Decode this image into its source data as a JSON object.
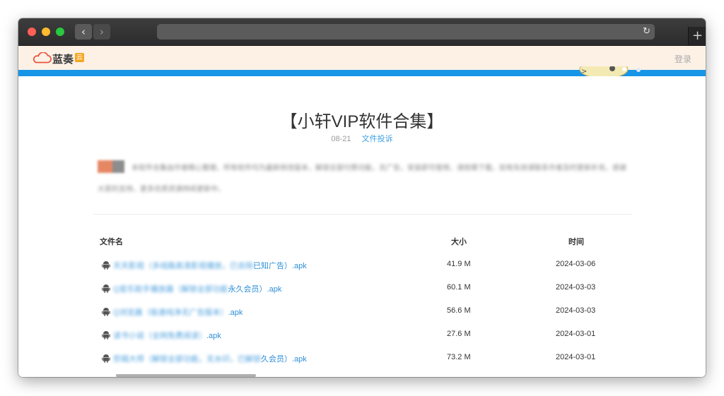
{
  "browser": {
    "back_glyph": "‹",
    "forward_glyph": "›",
    "reload_glyph": "↻",
    "newtab_glyph": "+"
  },
  "site": {
    "logo_text": "蓝奏",
    "logo_badge": "云",
    "login_label": "登录",
    "brand_color": "#1795e6"
  },
  "file": {
    "title": "【小轩VIP软件合集】",
    "date": "08-21",
    "report_label": "文件投诉",
    "description": "本软件合集由作者精心整理，所有软件均为最新修改版本，解锁全部付费功能，无广告，安装即可使用，请按需下载，如有失效请联系作者及时更新补充，感谢大家的支持，更多优质资源持续更新中。"
  },
  "table": {
    "headers": {
      "name": "文件名",
      "size": "大小",
      "time": "时间"
    },
    "rows": [
      {
        "name_hidden": "天天影视（多线路高清影视播放，已去除",
        "name_visible": "已知广告）.apk",
        "size": "41.9 M",
        "time": "2024-03-06"
      },
      {
        "name_hidden": "Q音乐助手播放器（解锁全部功能",
        "name_visible": "永久会员）.apk",
        "size": "60.1 M",
        "time": "2024-03-03"
      },
      {
        "name_hidden": "Q浏览器（极速纯净无广告版本）",
        "name_visible": ".apk",
        "size": "56.6 M",
        "time": "2024-03-03"
      },
      {
        "name_hidden": "读书小说（全网免费阅读）",
        "name_visible": ".apk",
        "size": "27.6 M",
        "time": "2024-03-01"
      },
      {
        "name_hidden": "剪辑大师（解锁全部功能，无水印，已解锁",
        "name_visible": "久会员）.apk",
        "size": "73.2 M",
        "time": "2024-03-01"
      }
    ]
  }
}
